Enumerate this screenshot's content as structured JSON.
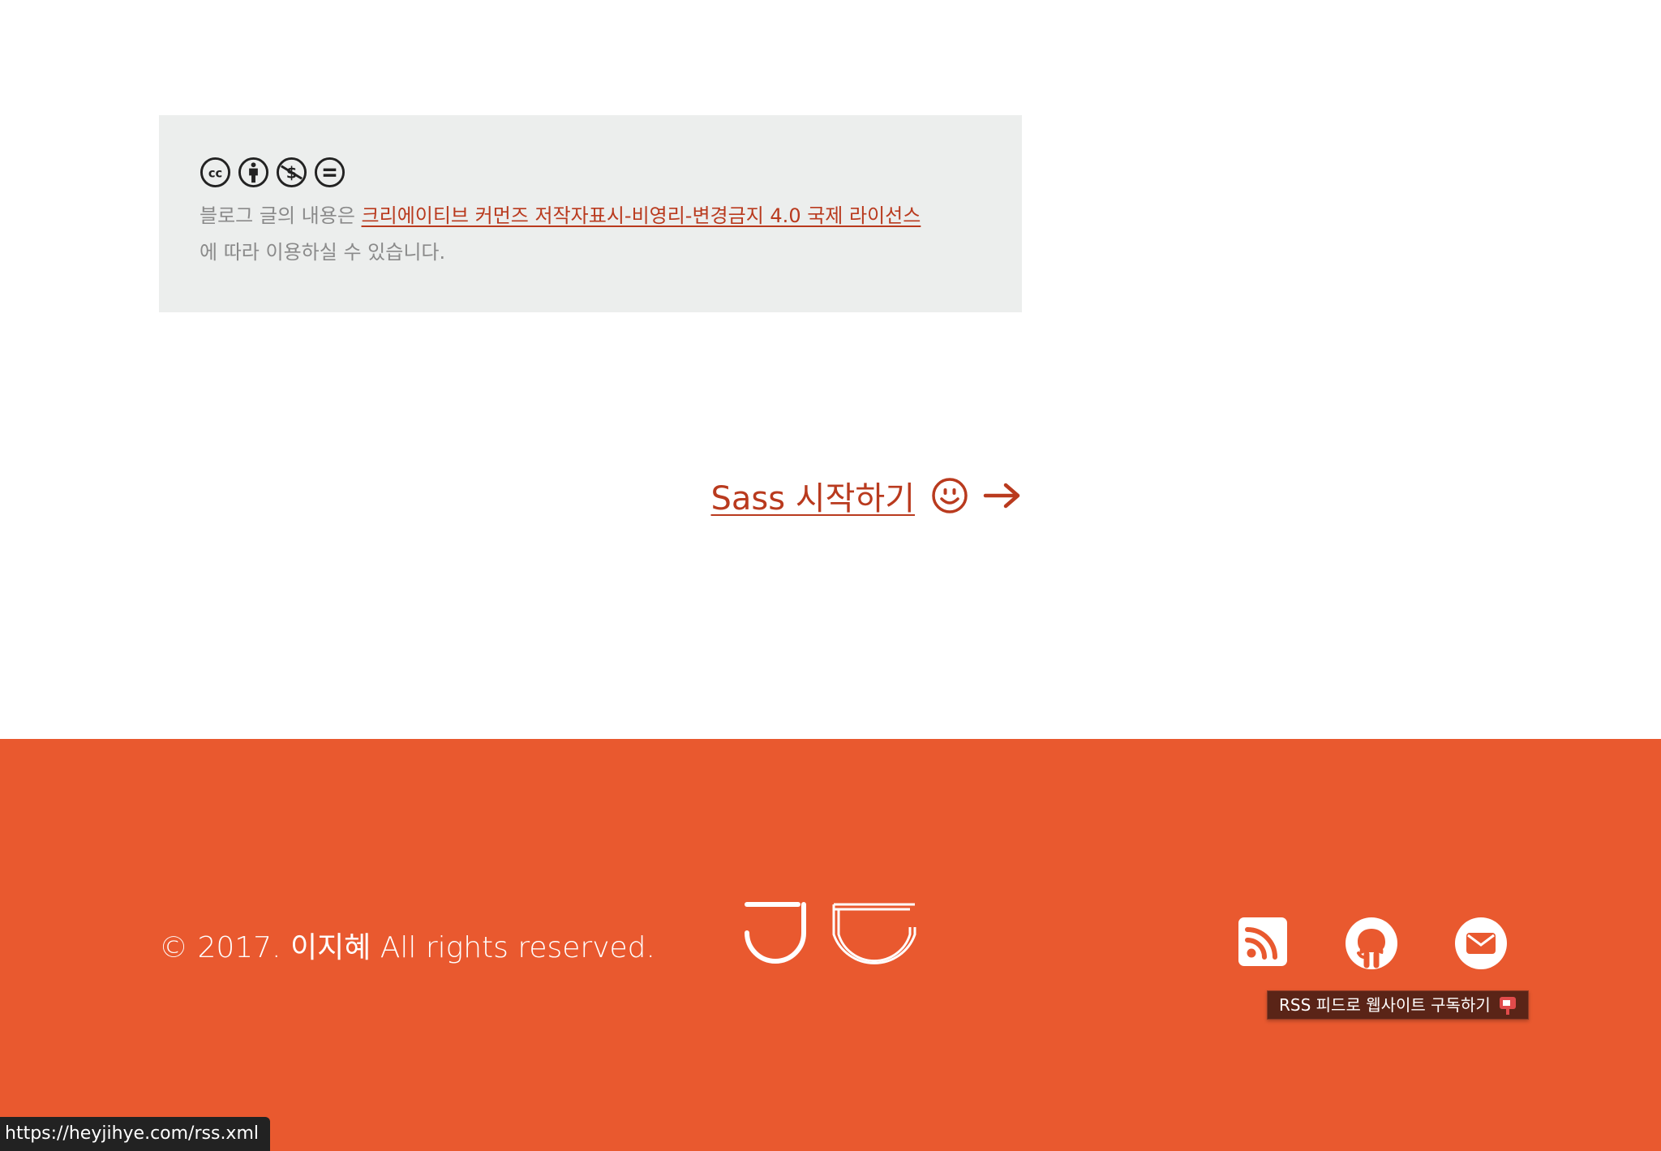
{
  "license": {
    "icons": [
      "cc-icon",
      "by-icon",
      "nc-icon",
      "nd-icon"
    ],
    "text_before": "블로그 글의 내용은 ",
    "link_label": "크리에이티브 커먼즈 저작자표시-비영리-변경금지 4.0 국제 라이선스",
    "text_after": "에 따라 이용하실 수 있습니다."
  },
  "next_post": {
    "label": "Sass 시작하기",
    "icons": [
      "smiley-icon",
      "arrow-right-icon"
    ]
  },
  "footer": {
    "copyright": "© 2017. 이지혜 All rights reserved.",
    "logo_icon": "jj-logo-icon",
    "social": [
      {
        "name": "rss-icon"
      },
      {
        "name": "github-icon"
      },
      {
        "name": "mail-icon"
      }
    ],
    "tooltip": "RSS 피드로 웹사이트 구독하기"
  },
  "status_bar": {
    "url": "https://heyjihye.com/rss.xml"
  },
  "colors": {
    "accent": "#e9592f",
    "link": "#b93a1e",
    "license_bg": "#eceeed"
  }
}
